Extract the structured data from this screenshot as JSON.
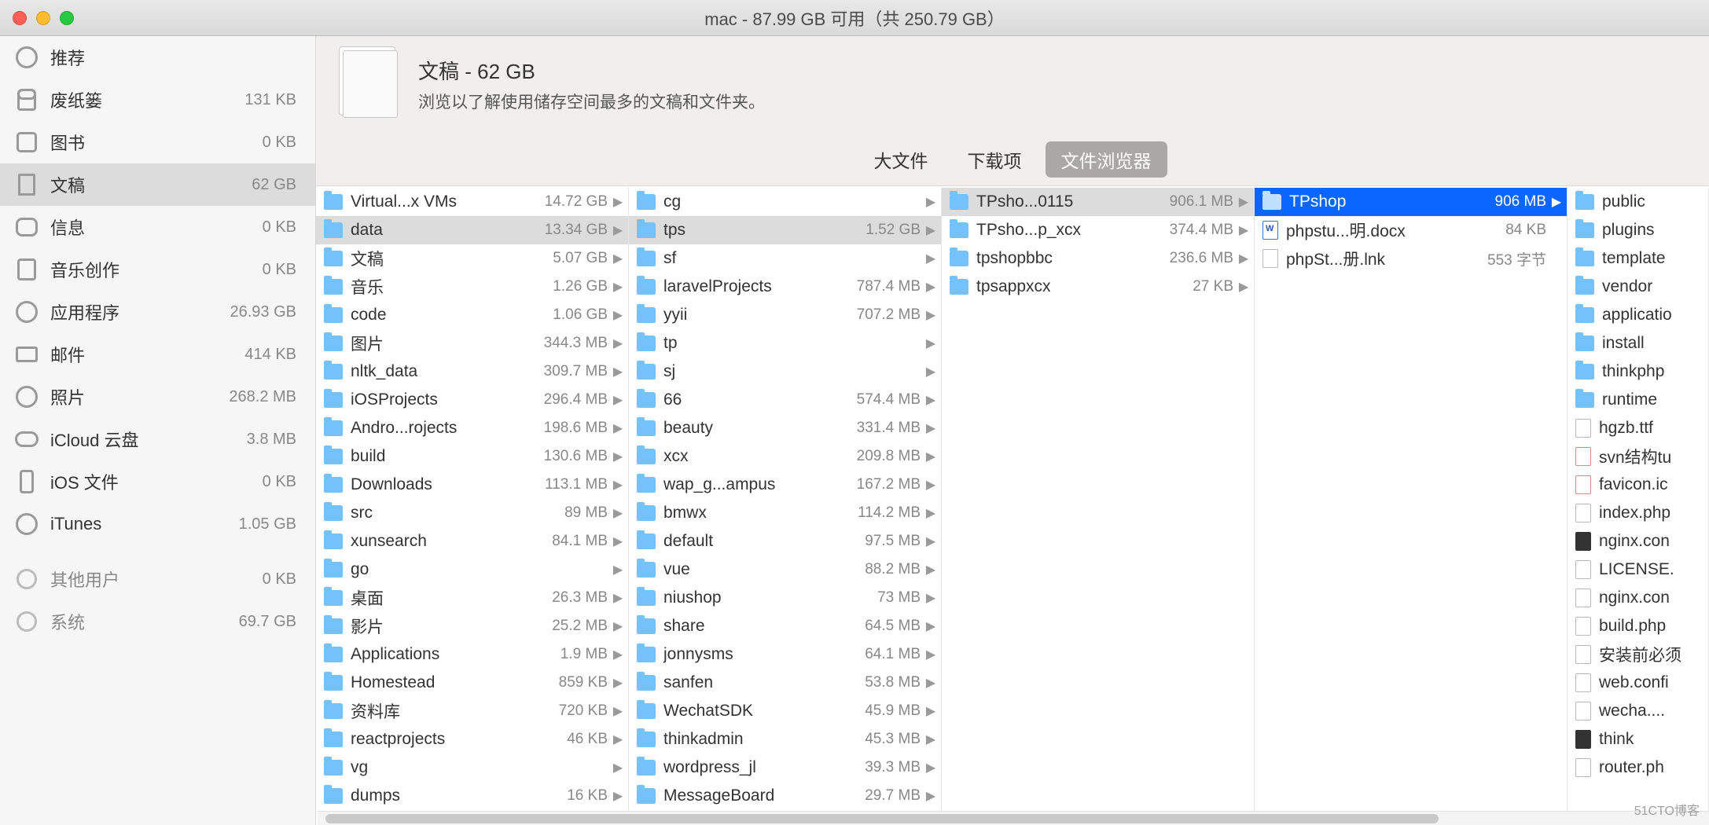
{
  "window": {
    "title": "mac - 87.99 GB 可用（共 250.79 GB）"
  },
  "sidebar": {
    "recommend": {
      "label": "推荐",
      "size": ""
    },
    "items": [
      {
        "icon": "trash",
        "label": "废纸篓",
        "size": "131 KB"
      },
      {
        "icon": "books",
        "label": "图书",
        "size": "0 KB"
      },
      {
        "icon": "docs",
        "label": "文稿",
        "size": "62 GB",
        "selected": true
      },
      {
        "icon": "messages",
        "label": "信息",
        "size": "0 KB"
      },
      {
        "icon": "music",
        "label": "音乐创作",
        "size": "0 KB"
      },
      {
        "icon": "apps",
        "label": "应用程序",
        "size": "26.93 GB"
      },
      {
        "icon": "mail",
        "label": "邮件",
        "size": "414 KB"
      },
      {
        "icon": "photos",
        "label": "照片",
        "size": "268.2 MB"
      },
      {
        "icon": "icloud",
        "label": "iCloud 云盘",
        "size": "3.8 MB"
      },
      {
        "icon": "ios",
        "label": "iOS 文件",
        "size": "0 KB"
      },
      {
        "icon": "itunes",
        "label": "iTunes",
        "size": "1.05 GB"
      }
    ],
    "others": [
      {
        "icon": "users",
        "label": "其他用户",
        "size": "0 KB"
      },
      {
        "icon": "system",
        "label": "系统",
        "size": "69.7 GB"
      }
    ]
  },
  "header": {
    "title": "文稿 - 62 GB",
    "subtitle": "浏览以了解使用储存空间最多的文稿和文件夹。"
  },
  "tabs": [
    {
      "label": "大文件",
      "active": false
    },
    {
      "label": "下载项",
      "active": false
    },
    {
      "label": "文件浏览器",
      "active": true
    }
  ],
  "columns": [
    {
      "width": "c0",
      "items": [
        {
          "name": "Virtual...x VMs",
          "size": "14.72 GB",
          "type": "folder",
          "arrow": true
        },
        {
          "name": "data",
          "size": "13.34 GB",
          "type": "folder",
          "arrow": true,
          "sel": "gray"
        },
        {
          "name": "文稿",
          "size": "5.07 GB",
          "type": "folder",
          "arrow": true
        },
        {
          "name": "音乐",
          "size": "1.26 GB",
          "type": "folder",
          "arrow": true
        },
        {
          "name": "code",
          "size": "1.06 GB",
          "type": "folder",
          "arrow": true
        },
        {
          "name": "图片",
          "size": "344.3 MB",
          "type": "folder",
          "arrow": true
        },
        {
          "name": "nltk_data",
          "size": "309.7 MB",
          "type": "folder",
          "arrow": true
        },
        {
          "name": "iOSProjects",
          "size": "296.4 MB",
          "type": "folder",
          "arrow": true
        },
        {
          "name": "Andro...rojects",
          "size": "198.6 MB",
          "type": "folder",
          "arrow": true
        },
        {
          "name": "build",
          "size": "130.6 MB",
          "type": "folder",
          "arrow": true
        },
        {
          "name": "Downloads",
          "size": "113.1 MB",
          "type": "folder",
          "arrow": true
        },
        {
          "name": "src",
          "size": "89 MB",
          "type": "folder",
          "arrow": true
        },
        {
          "name": "xunsearch",
          "size": "84.1 MB",
          "type": "folder",
          "arrow": true
        },
        {
          "name": "go",
          "size": "",
          "type": "folder",
          "arrow": true
        },
        {
          "name": "桌面",
          "size": "26.3 MB",
          "type": "folder",
          "arrow": true
        },
        {
          "name": "影片",
          "size": "25.2 MB",
          "type": "folder",
          "arrow": true
        },
        {
          "name": "Applications",
          "size": "1.9 MB",
          "type": "folder",
          "arrow": true
        },
        {
          "name": "Homestead",
          "size": "859 KB",
          "type": "folder",
          "arrow": true
        },
        {
          "name": "资料库",
          "size": "720 KB",
          "type": "folder",
          "arrow": true
        },
        {
          "name": "reactprojects",
          "size": "46 KB",
          "type": "folder",
          "arrow": true
        },
        {
          "name": "vg",
          "size": "",
          "type": "folder",
          "arrow": true
        },
        {
          "name": "dumps",
          "size": "16 KB",
          "type": "folder",
          "arrow": true
        }
      ]
    },
    {
      "width": "c1",
      "items": [
        {
          "name": "cg",
          "size": "",
          "type": "folder",
          "arrow": true
        },
        {
          "name": "tps",
          "size": "1.52 GB",
          "type": "folder",
          "arrow": true,
          "sel": "gray"
        },
        {
          "name": "sf",
          "size": "",
          "type": "folder",
          "arrow": true
        },
        {
          "name": "laravelProjects",
          "size": "787.4 MB",
          "type": "folder",
          "arrow": true
        },
        {
          "name": "yyii",
          "size": "707.2 MB",
          "type": "folder",
          "arrow": true
        },
        {
          "name": "tp",
          "size": "",
          "type": "folder",
          "arrow": true
        },
        {
          "name": "sj",
          "size": "",
          "type": "folder",
          "arrow": true
        },
        {
          "name": "66",
          "size": "574.4 MB",
          "type": "folder",
          "arrow": true
        },
        {
          "name": "beauty",
          "size": "331.4 MB",
          "type": "folder",
          "arrow": true
        },
        {
          "name": "xcx",
          "size": "209.8 MB",
          "type": "folder",
          "arrow": true
        },
        {
          "name": "wap_g...ampus",
          "size": "167.2 MB",
          "type": "folder",
          "arrow": true
        },
        {
          "name": "bmwx",
          "size": "114.2 MB",
          "type": "folder",
          "arrow": true
        },
        {
          "name": "default",
          "size": "97.5 MB",
          "type": "folder",
          "arrow": true
        },
        {
          "name": "vue",
          "size": "88.2 MB",
          "type": "folder",
          "arrow": true
        },
        {
          "name": "niushop",
          "size": "73 MB",
          "type": "folder",
          "arrow": true
        },
        {
          "name": "share",
          "size": "64.5 MB",
          "type": "folder",
          "arrow": true
        },
        {
          "name": "jonnysms",
          "size": "64.1 MB",
          "type": "folder",
          "arrow": true
        },
        {
          "name": "sanfen",
          "size": "53.8 MB",
          "type": "folder",
          "arrow": true
        },
        {
          "name": "WechatSDK",
          "size": "45.9 MB",
          "type": "folder",
          "arrow": true
        },
        {
          "name": "thinkadmin",
          "size": "45.3 MB",
          "type": "folder",
          "arrow": true
        },
        {
          "name": "wordpress_jl",
          "size": "39.3 MB",
          "type": "folder",
          "arrow": true
        },
        {
          "name": "MessageBoard",
          "size": "29.7 MB",
          "type": "folder",
          "arrow": true
        }
      ]
    },
    {
      "width": "c2",
      "items": [
        {
          "name": "TPsho...0115",
          "size": "906.1 MB",
          "type": "folder",
          "arrow": true,
          "sel": "gray"
        },
        {
          "name": "TPsho...p_xcx",
          "size": "374.4 MB",
          "type": "folder",
          "arrow": true
        },
        {
          "name": "tpshopbbc",
          "size": "236.6 MB",
          "type": "folder",
          "arrow": true
        },
        {
          "name": "tpsappxcx",
          "size": "27 KB",
          "type": "folder",
          "arrow": true
        }
      ]
    },
    {
      "width": "c3",
      "items": [
        {
          "name": "TPshop",
          "size": "906 MB",
          "type": "folder",
          "arrow": true,
          "sel": "blue"
        },
        {
          "name": "phpstu...明.docx",
          "size": "84 KB",
          "type": "wfile",
          "arrow": false
        },
        {
          "name": "phpSt...册.lnk",
          "size": "553 字节",
          "type": "file",
          "arrow": false
        }
      ]
    },
    {
      "width": "c4",
      "items": [
        {
          "name": "public",
          "size": "",
          "type": "folder",
          "arrow": false
        },
        {
          "name": "plugins",
          "size": "",
          "type": "folder",
          "arrow": false
        },
        {
          "name": "template",
          "size": "",
          "type": "folder",
          "arrow": false
        },
        {
          "name": "vendor",
          "size": "",
          "type": "folder",
          "arrow": false
        },
        {
          "name": "applicatio",
          "size": "",
          "type": "folder",
          "arrow": false
        },
        {
          "name": "install",
          "size": "",
          "type": "folder",
          "arrow": false
        },
        {
          "name": "thinkphp",
          "size": "",
          "type": "folder",
          "arrow": false
        },
        {
          "name": "runtime",
          "size": "",
          "type": "folder",
          "arrow": false
        },
        {
          "name": "hgzb.ttf",
          "size": "",
          "type": "ttf",
          "arrow": false
        },
        {
          "name": "svn结构tu",
          "size": "",
          "type": "red",
          "arrow": false
        },
        {
          "name": "favicon.ic",
          "size": "",
          "type": "red",
          "arrow": false
        },
        {
          "name": "index.php",
          "size": "",
          "type": "file",
          "arrow": false
        },
        {
          "name": "nginx.con",
          "size": "",
          "type": "dark",
          "arrow": false
        },
        {
          "name": "LICENSE.",
          "size": "",
          "type": "file",
          "arrow": false
        },
        {
          "name": "nginx.con",
          "size": "",
          "type": "file",
          "arrow": false
        },
        {
          "name": "build.php",
          "size": "",
          "type": "file",
          "arrow": false
        },
        {
          "name": "安装前必须",
          "size": "",
          "type": "file",
          "arrow": false
        },
        {
          "name": "web.confi",
          "size": "",
          "type": "file",
          "arrow": false
        },
        {
          "name": "wecha....",
          "size": "",
          "type": "file",
          "arrow": false
        },
        {
          "name": "think",
          "size": "",
          "type": "dark",
          "arrow": false
        },
        {
          "name": "router.ph",
          "size": "",
          "type": "file",
          "arrow": false
        }
      ]
    }
  ],
  "watermark": "51CTO博客"
}
